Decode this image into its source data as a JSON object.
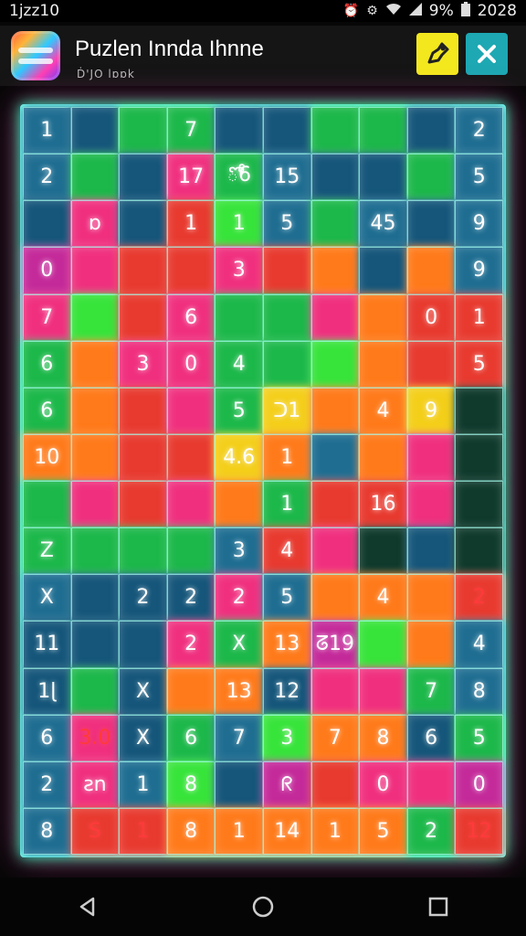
{
  "status_bar": {
    "time_left": "1jzz10",
    "battery": "9%",
    "time_right": "2028"
  },
  "header": {
    "title": "Puzlen Innda Ihnne",
    "subtitle": "Ḋ'JO lɒɒk",
    "hint_icon": "puzzle-hint-icon",
    "close_icon": "close-icon"
  },
  "colors": {
    "B": "#1f6e92",
    "T": "#15567a",
    "G": "#1cb84a",
    "g": "#37e43a",
    "P": "#f0307f",
    "R": "#e83a2f",
    "O": "#ff7a1a",
    "Y": "#f4cf1a",
    "D": "#0f3a2c",
    "M": "#c42a9a"
  },
  "board": {
    "rows": [
      {
        "c": [
          "B",
          "T",
          "G",
          "G",
          "T",
          "T",
          "G",
          "G",
          "T",
          "B"
        ],
        "v": [
          "1",
          "",
          "",
          "7",
          "",
          "",
          "",
          "",
          "",
          "2"
        ]
      },
      {
        "c": [
          "B",
          "G",
          "T",
          "P",
          "G",
          "B",
          "T",
          "T",
          "G",
          "B"
        ],
        "v": [
          "2",
          "",
          "",
          "17",
          "ో6",
          "15",
          "",
          "",
          "",
          "5"
        ]
      },
      {
        "c": [
          "T",
          "P",
          "T",
          "R",
          "g",
          "B",
          "G",
          "B",
          "T",
          "B"
        ],
        "v": [
          "",
          "ɒ",
          "",
          "1",
          "1",
          "5",
          "",
          "45",
          "",
          "9"
        ]
      },
      {
        "c": [
          "M",
          "P",
          "R",
          "R",
          "P",
          "R",
          "O",
          "T",
          "O",
          "B"
        ],
        "v": [
          "0",
          "",
          "",
          "",
          "3",
          "",
          "",
          "",
          "",
          "9"
        ]
      },
      {
        "c": [
          "P",
          "g",
          "R",
          "P",
          "G",
          "G",
          "P",
          "O",
          "R",
          "R"
        ],
        "v": [
          "7",
          "",
          "",
          "6",
          "",
          "",
          "",
          "",
          "0",
          "1"
        ]
      },
      {
        "c": [
          "G",
          "O",
          "P",
          "P",
          "G",
          "G",
          "g",
          "O",
          "R",
          "R"
        ],
        "v": [
          "6",
          "",
          "3",
          "0",
          "4",
          "",
          "",
          "",
          "",
          "5"
        ]
      },
      {
        "c": [
          "G",
          "O",
          "R",
          "P",
          "G",
          "Y",
          "O",
          "O",
          "Y",
          "D"
        ],
        "v": [
          "6",
          "",
          "",
          "",
          "5",
          "ᑐ1",
          "",
          "4",
          "9",
          ""
        ]
      },
      {
        "c": [
          "O",
          "O",
          "R",
          "R",
          "Y",
          "O",
          "B",
          "O",
          "P",
          "D"
        ],
        "v": [
          "10",
          "",
          "",
          "",
          "4.6",
          "1",
          "",
          "",
          "",
          ""
        ]
      },
      {
        "c": [
          "G",
          "P",
          "R",
          "P",
          "O",
          "G",
          "R",
          "R",
          "P",
          "D"
        ],
        "v": [
          "",
          "",
          "",
          "",
          "",
          "1",
          "",
          "16",
          "",
          ""
        ]
      },
      {
        "c": [
          "G",
          "G",
          "G",
          "G",
          "B",
          "R",
          "P",
          "D",
          "T",
          "D"
        ],
        "v": [
          "Z",
          "",
          "",
          "",
          "3",
          "4",
          "",
          "",
          "",
          ""
        ]
      },
      {
        "c": [
          "B",
          "T",
          "T",
          "T",
          "P",
          "B",
          "O",
          "O",
          "O",
          "R"
        ],
        "v": [
          "X",
          "",
          "2",
          "2",
          "2",
          "5",
          "",
          "4",
          "",
          "2"
        ]
      },
      {
        "c": [
          "T",
          "T",
          "T",
          "P",
          "G",
          "O",
          "M",
          "g",
          "O",
          "B"
        ],
        "v": [
          "11",
          "",
          "",
          "2",
          "X",
          "13",
          "ᘔ19",
          "",
          "",
          "4"
        ]
      },
      {
        "c": [
          "T",
          "G",
          "T",
          "O",
          "O",
          "T",
          "P",
          "P",
          "G",
          "B"
        ],
        "v": [
          "1ɭ",
          "",
          "X",
          "",
          "13",
          "12",
          "",
          "",
          "7",
          "8"
        ]
      },
      {
        "c": [
          "B",
          "P",
          "T",
          "G",
          "B",
          "g",
          "O",
          "O",
          "T",
          "G"
        ],
        "v": [
          "6",
          "3.0",
          "X",
          "6",
          "7",
          "3",
          "7",
          "8",
          "6",
          "5"
        ]
      },
      {
        "c": [
          "B",
          "P",
          "B",
          "g",
          "T",
          "M",
          "R",
          "P",
          "P",
          "M"
        ],
        "v": [
          "2",
          "ƨn",
          "1",
          "8",
          "",
          "ᖇ",
          "",
          "0",
          "",
          "0"
        ]
      },
      {
        "c": [
          "B",
          "R",
          "R",
          "O",
          "O",
          "O",
          "O",
          "O",
          "G",
          "R"
        ],
        "v": [
          "8",
          "S",
          "1",
          "8",
          "1",
          "14",
          "1",
          "5",
          "2",
          "12"
        ]
      }
    ]
  },
  "nav": {
    "back_icon": "back-icon",
    "home_icon": "home-icon",
    "recents_icon": "recents-icon"
  }
}
